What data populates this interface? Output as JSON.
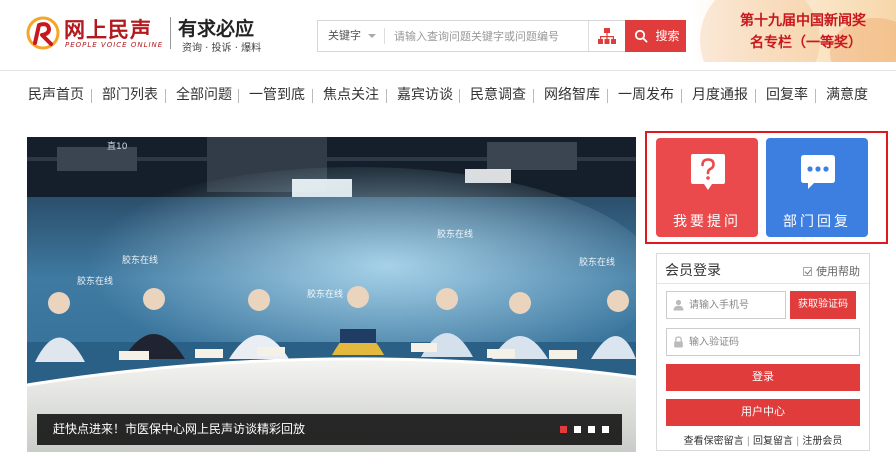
{
  "header": {
    "logo_title": "网上民声",
    "logo_subtitle_en": "PEOPLE VOICE ONLINE",
    "slogan": "有求必应",
    "slogan_sub": "资询 · 投诉 · 爆料",
    "search": {
      "type_label": "关键字",
      "placeholder": "请输入查询问题关键字或问题编号",
      "button_label": "搜索"
    },
    "banner": {
      "line1": "第十九届中国新闻奖",
      "line2": "名专栏（一等奖）"
    }
  },
  "nav": {
    "items": [
      "民声首页",
      "部门列表",
      "全部问题",
      "一管到底",
      "焦点关注",
      "嘉宾访谈",
      "民意调查",
      "网络智库",
      "一周发布",
      "月度通报",
      "回复率",
      "满意度"
    ]
  },
  "carousel": {
    "caption": "赶快点进来！市医保中心网上民声访谈精彩回放",
    "slide_count": 4,
    "active_index": 0,
    "scene_text": {
      "studio_sign": "胶东在线",
      "stand_lamp": "直10"
    }
  },
  "actions": {
    "ask_label": "我要提问",
    "reply_label": "部门回复"
  },
  "login": {
    "title": "会员登录",
    "help_label": "使用帮助",
    "phone_placeholder": "请输入手机号",
    "get_code_label": "获取验证码",
    "code_placeholder": "输入验证码",
    "login_label": "登录",
    "member_center_label": "用户中心",
    "links": [
      "查看保密留言",
      "回复留言",
      "注册会员"
    ]
  },
  "colors": {
    "brand_red": "#e03c3c",
    "logo_red": "#b3191d",
    "ask_red": "#ea4a4c",
    "reply_blue": "#3d7fe0",
    "highlight_frame": "#e0191e"
  }
}
